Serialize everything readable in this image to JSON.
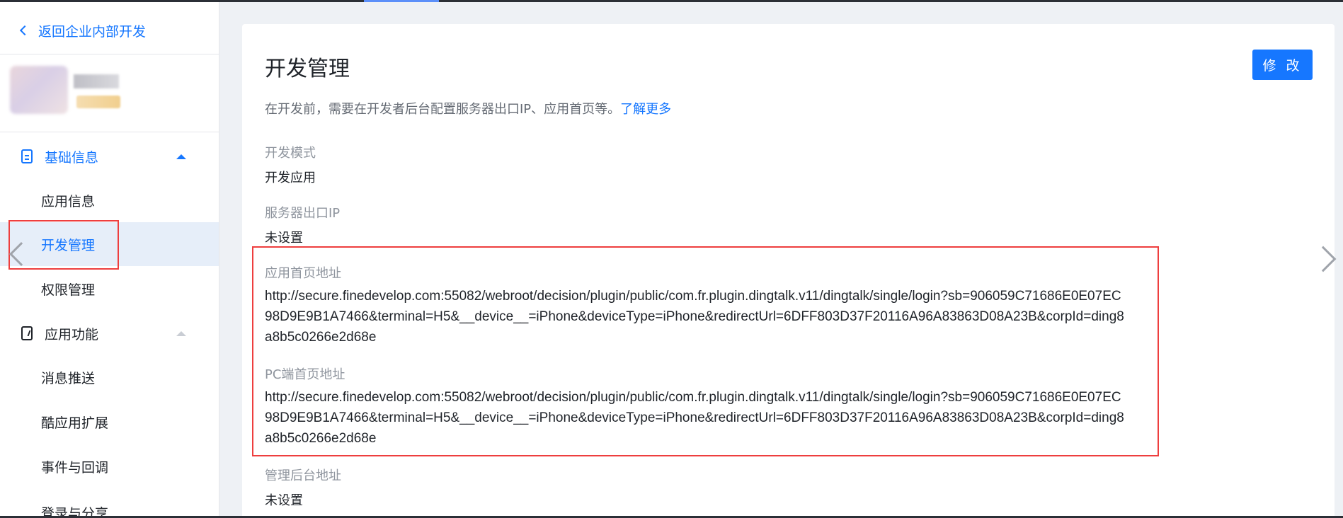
{
  "sidebar": {
    "back_label": "返回企业内部开发",
    "groups": [
      {
        "label": "基础信息",
        "expanded": true,
        "icon": "document-icon"
      },
      {
        "label": "应用功能",
        "expanded": false,
        "icon": "phone-icon"
      }
    ],
    "items": [
      {
        "label": "应用信息",
        "active": false
      },
      {
        "label": "开发管理",
        "active": true
      },
      {
        "label": "权限管理",
        "active": false
      },
      {
        "label": "消息推送",
        "active": false
      },
      {
        "label": "酷应用扩展",
        "active": false
      },
      {
        "label": "事件与回调",
        "active": false
      },
      {
        "label": "登录与分享",
        "active": false
      }
    ]
  },
  "main": {
    "title": "开发管理",
    "edit_button": "修 改",
    "intro_text": "在开发前，需要在开发者后台配置服务器出口IP、应用首页等。",
    "intro_link": "了解更多",
    "fields": [
      {
        "label": "开发模式",
        "value": "开发应用"
      },
      {
        "label": "服务器出口IP",
        "value": "未设置"
      },
      {
        "label": "应用首页地址",
        "value": "http://secure.finedevelop.com:55082/webroot/decision/plugin/public/com.fr.plugin.dingtalk.v11/dingtalk/single/login?sb=906059C71686E0E07EC98D9E9B1A7466&terminal=H5&__device__=iPhone&deviceType=iPhone&redirectUrl=6DFF803D37F20116A96A83863D08A23B&corpId=ding8a8b5c0266e2d68e"
      },
      {
        "label": "PC端首页地址",
        "value": "http://secure.finedevelop.com:55082/webroot/decision/plugin/public/com.fr.plugin.dingtalk.v11/dingtalk/single/login?sb=906059C71686E0E07EC98D9E9B1A7466&terminal=H5&__device__=iPhone&deviceType=iPhone&redirectUrl=6DFF803D37F20116A96A83863D08A23B&corpId=ding8a8b5c0266e2d68e"
      },
      {
        "label": "管理后台地址",
        "value": "未设置"
      }
    ]
  },
  "colors": {
    "accent": "#1677ff",
    "highlight": "#ee3e3e",
    "active_bg": "#e6eef9"
  }
}
